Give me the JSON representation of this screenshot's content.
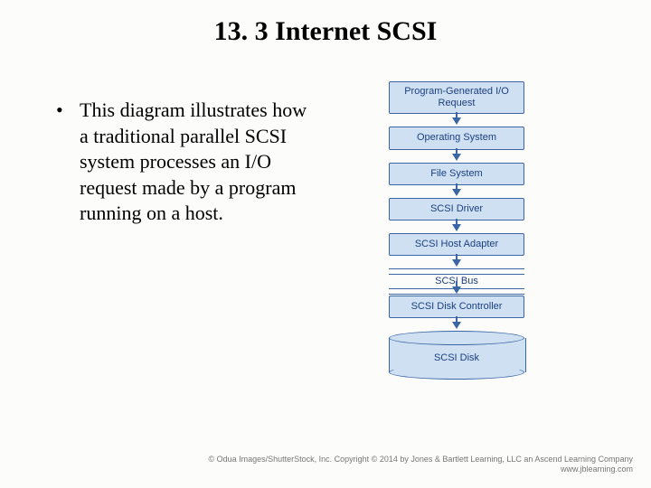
{
  "title": "13. 3 Internet SCSI",
  "bullet": "This diagram illustrates how a traditional parallel SCSI system processes an I/O request made by a program running on a host.",
  "diagram": {
    "steps": [
      "Program-Generated I/O Request",
      "Operating System",
      "File System",
      "SCSI Driver",
      "SCSI Host Adapter"
    ],
    "bus": "SCSI Bus",
    "controller": "SCSI Disk Controller",
    "disk": "SCSI Disk"
  },
  "footer": {
    "line1": "© Odua Images/ShutterStock, Inc. Copyright © 2014 by Jones & Bartlett Learning, LLC an Ascend Learning Company",
    "line2": "www.jblearning.com"
  }
}
